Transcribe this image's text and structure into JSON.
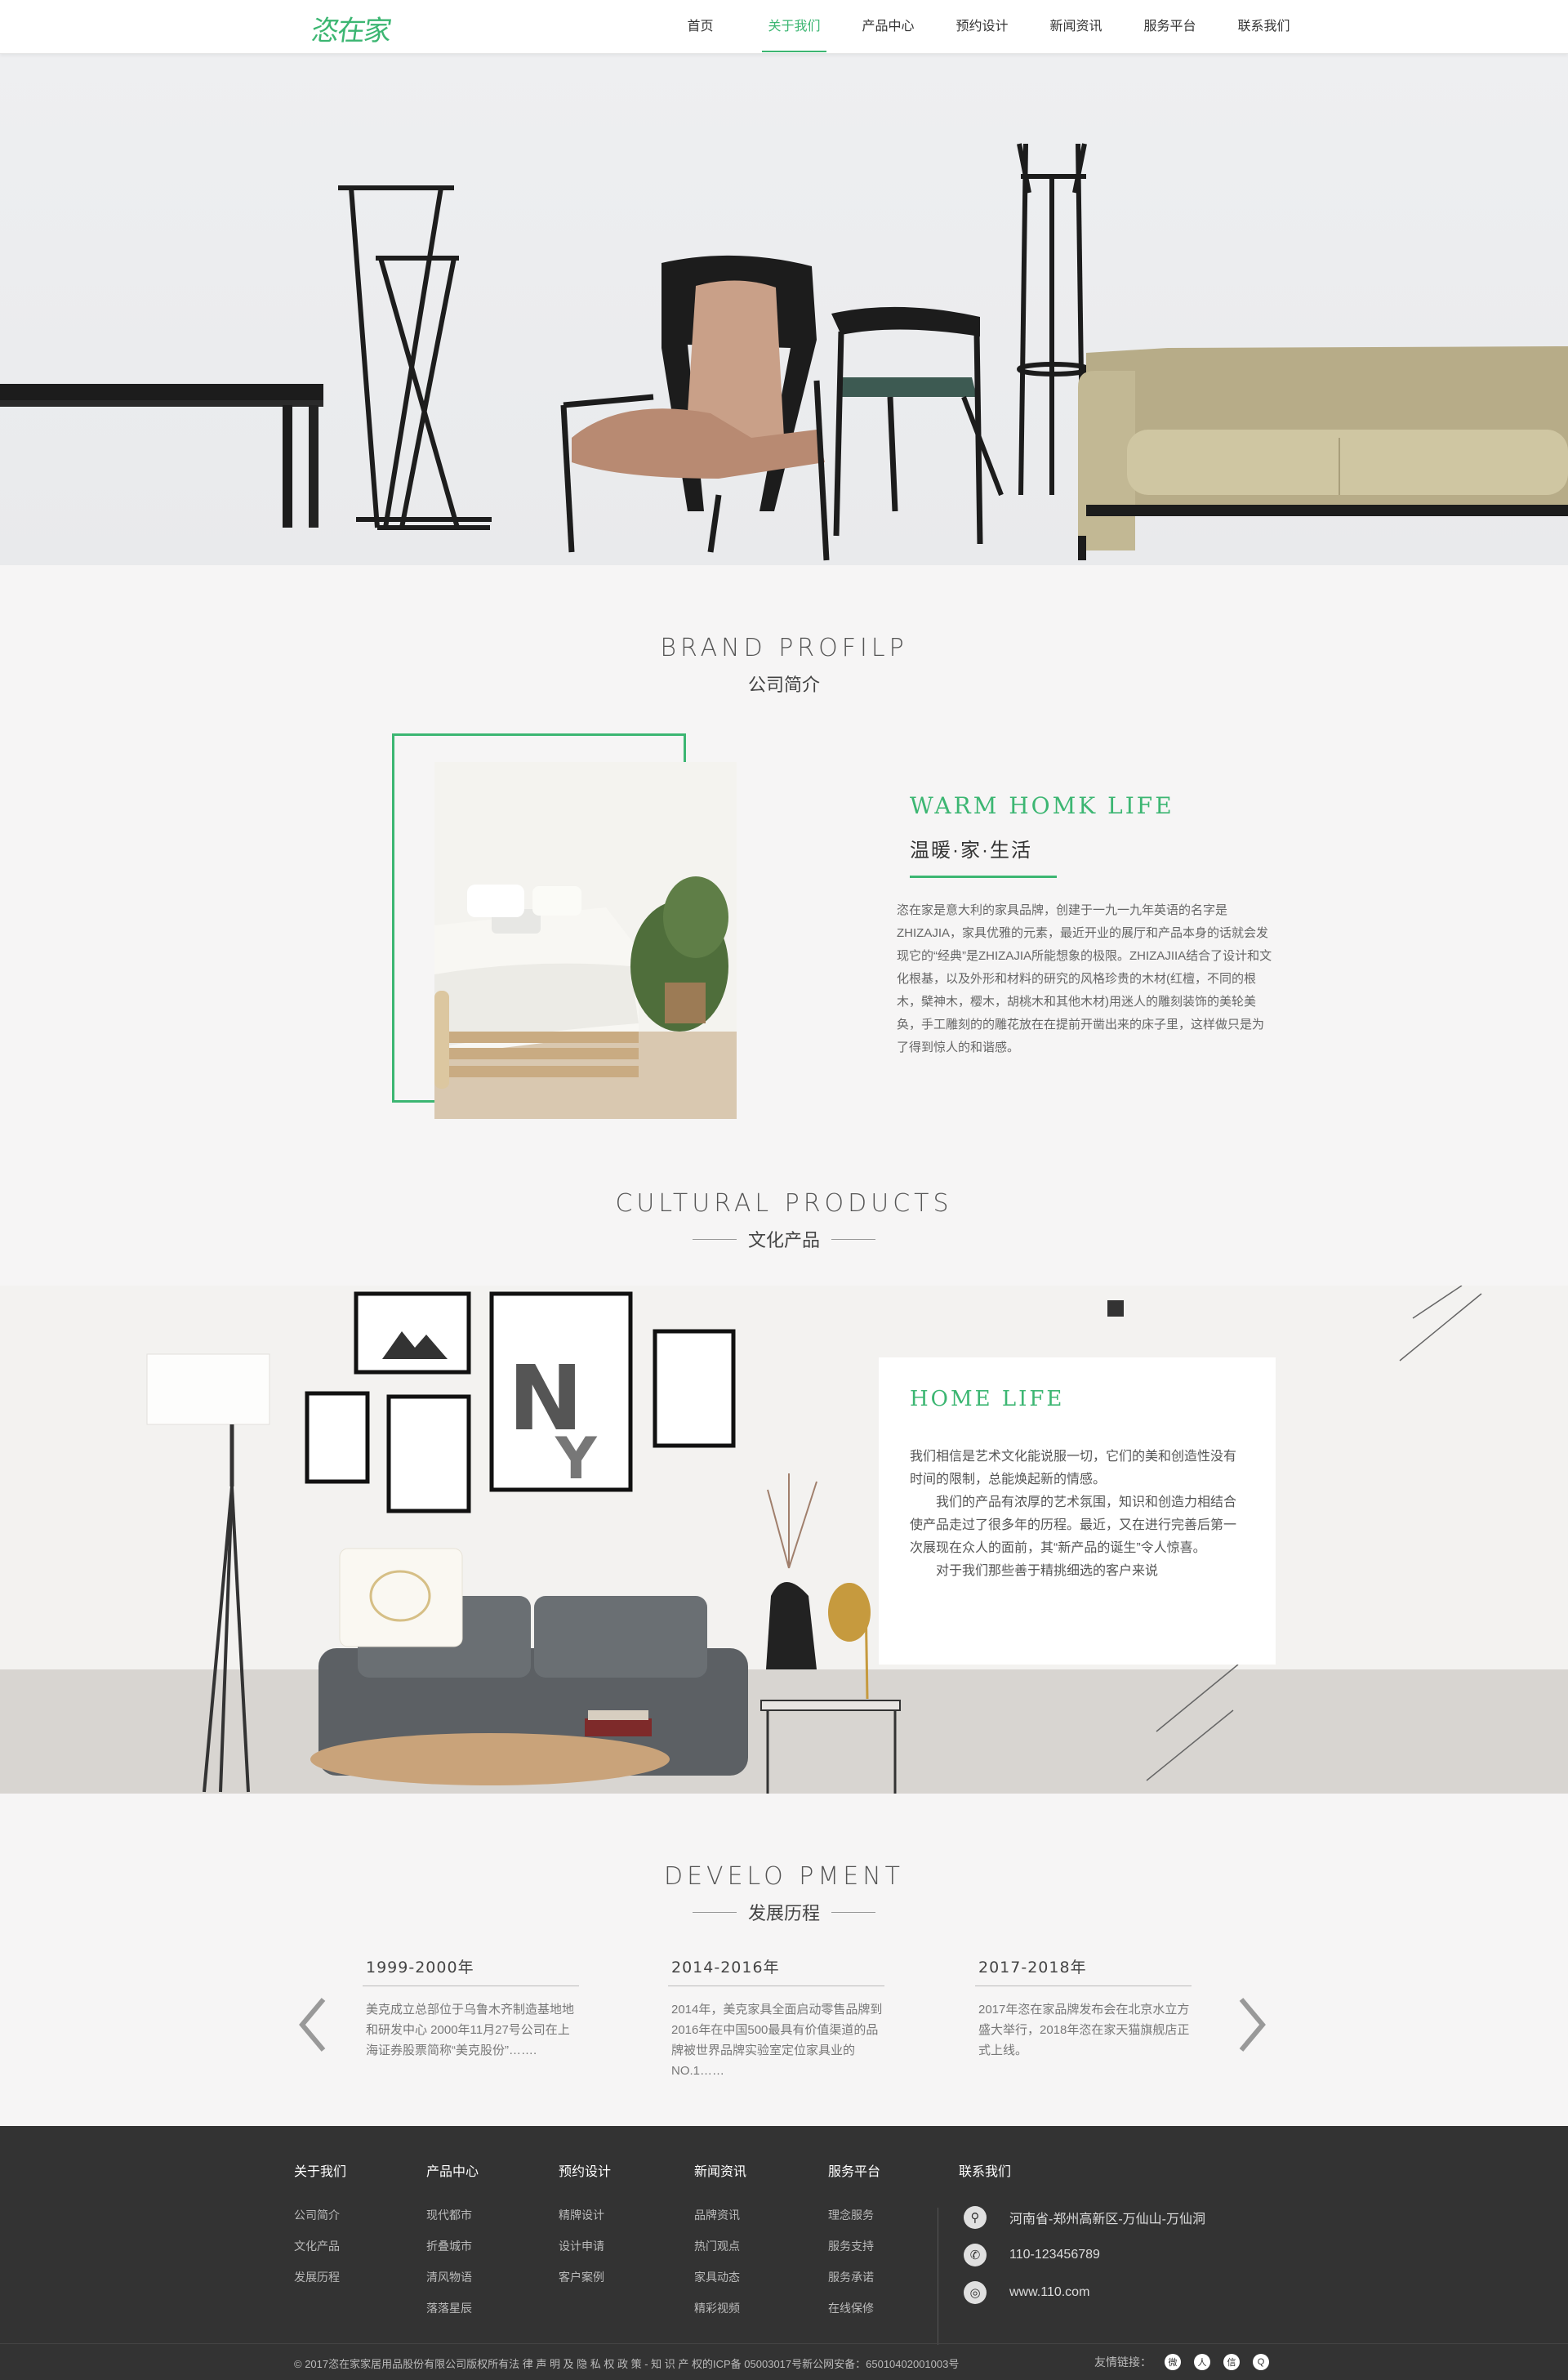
{
  "header": {
    "logo": "恣在家",
    "nav": [
      "首页",
      "关于我们",
      "产品中心",
      "预约设计",
      "新闻资讯",
      "服务平台",
      "联系我们"
    ],
    "active_index": 1
  },
  "brand": {
    "title_en": "BRAND PROFILP",
    "title_cn": "公司简介",
    "heading_en": "WARM HOMK LIFE",
    "heading_cn": "温暖·家·生活",
    "description": "恣在家是意大利的家具品牌，创建于一九一九年英语的名字是ZHIZAJIA，家具优雅的元素，最近开业的展厅和产品本身的话就会发现它的“经典”是ZHIZAJIA所能想象的极限。ZHIZAJIIA结合了设计和文化根基，以及外形和材料的研究的风格珍贵的木材(红檀，不同的根木，檗神木，樱木，胡桃木和其他木材)用迷人的雕刻装饰的美轮美奂，手工雕刻的的雕花放在在提前开凿出来的床子里，这样做只是为了得到惊人的和谐感。"
  },
  "cultural": {
    "title_en": "CULTURAL PRODUCTS",
    "title_cn": "文化产品",
    "card_heading": "HOME LIFE",
    "paragraphs": [
      "我们相信是艺术文化能说服一切，它们的美和创造性没有时间的限制，总能焕起新的情感。",
      "　　我们的产品有浓厚的艺术氛围，知识和创造力相结合使产品走过了很多年的历程。最近，又在进行完善后第一次展现在众人的面前，其“新产品的诞生”令人惊喜。",
      "　　对于我们那些善于精挑细选的客户来说"
    ]
  },
  "development": {
    "title_en": "DEVELO PMENT",
    "title_cn": "发展历程",
    "items": [
      {
        "year": "1999-2000年",
        "text": "美克成立总部位于乌鲁木齐制造基地地和研发中心 2000年11月27号公司在上海证券股票简称“美克股份”……."
      },
      {
        "year": "2014-2016年",
        "text": "2014年，美克家具全面启动零售品牌到2016年在中国500最具有价值渠道的品牌被世界品牌实验室定位家具业的NO.1……"
      },
      {
        "year": "2017-2018年",
        "text": "2017年恣在家品牌发布会在北京水立方盛大举行，2018年恣在家天猫旗舰店正式上线。"
      }
    ]
  },
  "footer": {
    "columns": [
      {
        "head": "关于我们",
        "links": [
          "公司简介",
          "文化产品",
          "发展历程"
        ]
      },
      {
        "head": "产品中心",
        "links": [
          "现代都市",
          "折叠城市",
          "清风物语",
          "落落星辰"
        ]
      },
      {
        "head": "预约设计",
        "links": [
          "精牌设计",
          "设计申请",
          "客户案例"
        ]
      },
      {
        "head": "新闻资讯",
        "links": [
          "品牌资讯",
          "热门观点",
          "家具动态",
          "精彩视频"
        ]
      },
      {
        "head": "服务平台",
        "links": [
          "理念服务",
          "服务支持",
          "服务承诺",
          "在线保修"
        ]
      }
    ],
    "contact_head": "联系我们",
    "contacts": [
      {
        "icon": "location-icon",
        "text": "河南省-郑州高新区-万仙山-万仙洞"
      },
      {
        "icon": "phone-icon",
        "text": "110-123456789"
      },
      {
        "icon": "web-icon",
        "text": "www.110.com"
      }
    ],
    "copyright": "© 2017恣在家家居用品股份有限公司版权所有法 律 声 明 及 隐 私 权 政 策 - 知 识 产 权的ICP备 05003017号新公网安备：65010402001003号",
    "friends_label": "友情链接：",
    "social": [
      "weibo-icon",
      "renren-icon",
      "wechat-icon",
      "qq-icon"
    ]
  },
  "colors": {
    "accent": "#3cb672",
    "footer_bg": "#333333"
  }
}
